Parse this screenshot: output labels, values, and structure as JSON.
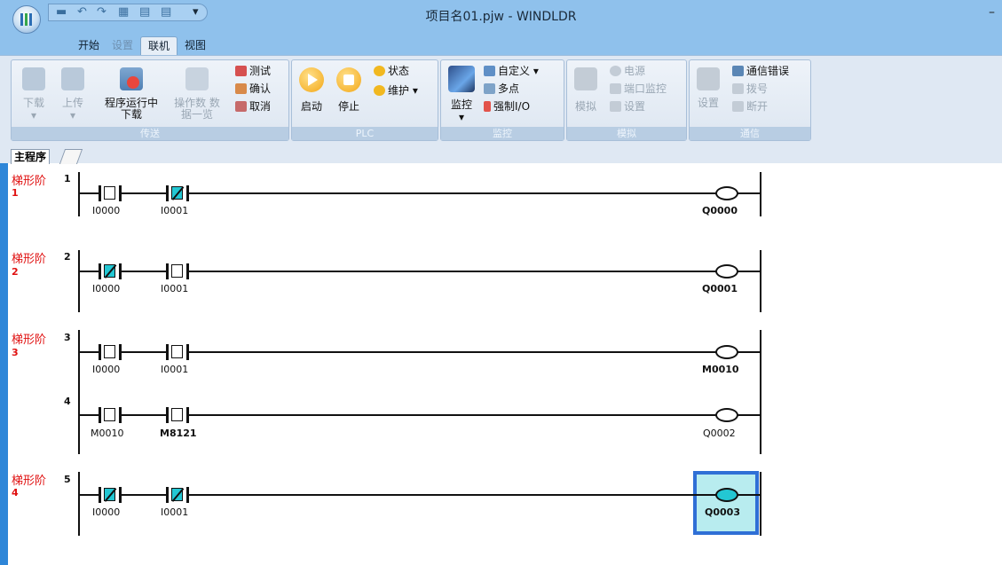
{
  "window": {
    "title": "项目名01.pjw - WINDLDR",
    "minimize": "–"
  },
  "qat": {
    "icons": [
      "save-icon",
      "undo-icon",
      "redo-icon",
      "monitor-small-icon",
      "download-small-icon",
      "upload-small-icon"
    ],
    "dropdown": "▾"
  },
  "tabs": [
    {
      "label": "开始",
      "state": "normal"
    },
    {
      "label": "设置",
      "state": "disabled"
    },
    {
      "label": "联机",
      "state": "active"
    },
    {
      "label": "视图",
      "state": "normal"
    }
  ],
  "ribbon": {
    "transfer": {
      "title": "传送",
      "download": "下载",
      "upload": "上传",
      "download_run_l1": "程序运行中",
      "download_run_l2": "下载",
      "data_list_l1": "操作数 数",
      "data_list_l2": "据一览",
      "test": "测试",
      "confirm": "确认",
      "cancel": "取消"
    },
    "plc": {
      "title": "PLC",
      "start": "启动",
      "stop": "停止",
      "status": "状态",
      "maintenance": "维护"
    },
    "monitor": {
      "title": "监控",
      "monitor": "监控",
      "custom": "自定义",
      "multipoint": "多点",
      "force_io": "强制I/O"
    },
    "simulate": {
      "title": "模拟",
      "simulate": "模拟",
      "power": "电源",
      "port_monitor": "端口监控",
      "settings": "设置"
    },
    "comm": {
      "title": "通信",
      "settings": "设置",
      "comm_error": "通信错误",
      "dial": "拨号",
      "disconnect": "断开"
    }
  },
  "doc_tab": {
    "label": "主程序"
  },
  "rungs": [
    {
      "title": "梯形阶",
      "num": "1",
      "lines": [
        {
          "line": "1",
          "contacts": [
            {
              "op": "I0000",
              "type": "NO"
            },
            {
              "op": "I0001",
              "type": "NC"
            }
          ],
          "coil": {
            "op": "Q0000",
            "bold": true
          }
        }
      ]
    },
    {
      "title": "梯形阶",
      "num": "2",
      "lines": [
        {
          "line": "2",
          "contacts": [
            {
              "op": "I0000",
              "type": "NC"
            },
            {
              "op": "I0001",
              "type": "NO"
            }
          ],
          "coil": {
            "op": "Q0001",
            "bold": true
          }
        }
      ]
    },
    {
      "title": "梯形阶",
      "num": "3",
      "lines": [
        {
          "line": "3",
          "contacts": [
            {
              "op": "I0000",
              "type": "NO"
            },
            {
              "op": "I0001",
              "type": "NO"
            }
          ],
          "coil": {
            "op": "M0010",
            "bold": true
          }
        },
        {
          "line": "4",
          "contacts": [
            {
              "op": "M0010",
              "type": "NO"
            },
            {
              "op": "M8121",
              "type": "NO"
            }
          ],
          "coil": {
            "op": "Q0002",
            "bold": false
          }
        }
      ]
    },
    {
      "title": "梯形阶",
      "num": "4",
      "lines": [
        {
          "line": "5",
          "contacts": [
            {
              "op": "I0000",
              "type": "NC"
            },
            {
              "op": "I0001",
              "type": "NC"
            }
          ],
          "coil": {
            "op": "Q0003",
            "bold": true,
            "selected": true
          }
        }
      ]
    }
  ]
}
